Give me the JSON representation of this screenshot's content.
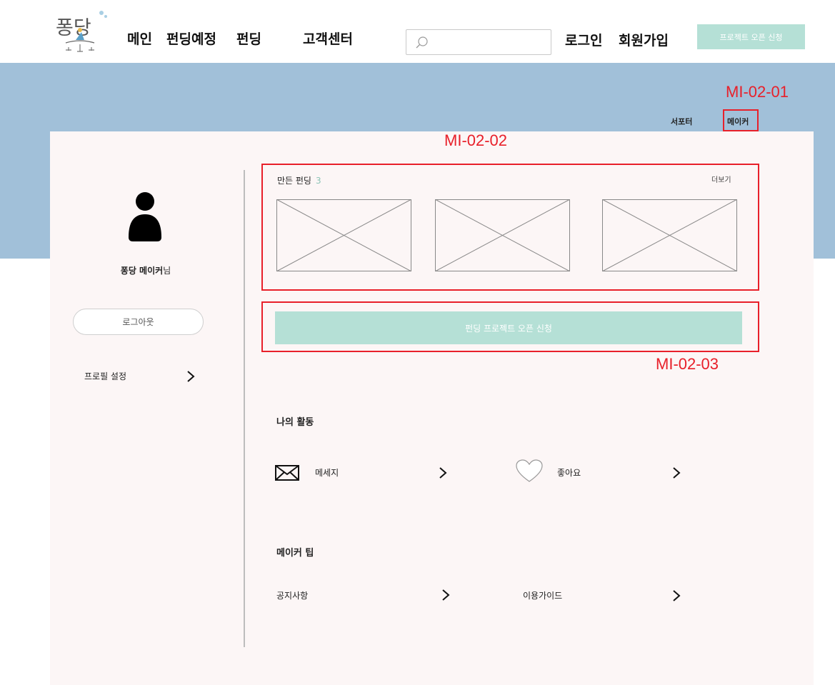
{
  "header": {
    "logo_text": "퐁당",
    "nav": [
      "메인",
      "펀딩예정",
      "펀딩",
      "고객센터"
    ],
    "search": {
      "placeholder": "",
      "value": ""
    },
    "login": "로그인",
    "signup": "회원가입",
    "open_project_button": "프로젝트 오픈 신청"
  },
  "annotations": [
    "MI-02-01",
    "MI-02-02",
    "MI-02-03"
  ],
  "role_tabs": {
    "supporter": "서포터",
    "maker": "메이커"
  },
  "profile": {
    "name": "퐁당 메이커",
    "suffix": "님",
    "logout": "로그아웃",
    "settings": "프로필 설정"
  },
  "made_fundings": {
    "title": "만든 펀딩",
    "count": "3",
    "more": "더보기"
  },
  "funding_open_button": "펀딩 프로젝트 오픈 신청",
  "activity": {
    "title": "나의 활동",
    "items": [
      {
        "label": "메세지",
        "icon": "envelope-icon"
      },
      {
        "label": "좋아요",
        "icon": "heart-icon"
      }
    ]
  },
  "tips": {
    "title": "메이커 팁",
    "items": [
      {
        "label": "공지사항"
      },
      {
        "label": "이용가이드"
      }
    ]
  },
  "colors": {
    "hero": "#a1c0d9",
    "accent_mint": "#b5e0d6",
    "panel": "#fcf6f6",
    "annotation_red": "#e8202a"
  }
}
